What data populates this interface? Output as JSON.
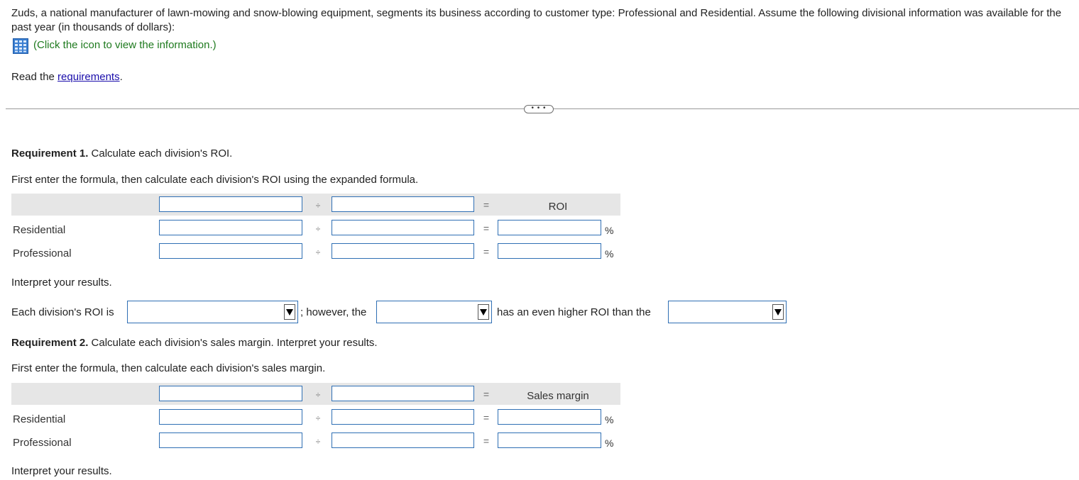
{
  "intro": {
    "text": "Zuds, a national manufacturer of lawn-mowing and snow-blowing equipment, segments its business according to customer type: Professional and Residential. Assume the following divisional information was available for the past year (in thousands of dollars):",
    "icon_hint": "(Click the icon to view the information.)",
    "read_prefix": "Read the ",
    "requirements_link": "requirements",
    "read_suffix": "."
  },
  "more_button": "• • •",
  "req1": {
    "label": "Requirement 1.",
    "text": " Calculate each division's ROI.",
    "instruction": "First enter the formula, then calculate each division's ROI using the expanded formula.",
    "result_header": "ROI",
    "divide_symbol": "÷",
    "equals_symbol": "=",
    "rows": [
      {
        "label": "Residential",
        "unit": "%"
      },
      {
        "label": "Professional",
        "unit": "%"
      }
    ],
    "interpret": "Interpret your results.",
    "sentence": {
      "part1": "Each division's ROI is",
      "part2": "; however, the",
      "part3": "has an even higher ROI than the"
    }
  },
  "req2": {
    "label": "Requirement 2.",
    "text": " Calculate each division's sales margin. Interpret your results.",
    "instruction": "First enter the formula, then calculate each division's sales margin.",
    "result_header": "Sales margin",
    "divide_symbol": "÷",
    "equals_symbol": "=",
    "rows": [
      {
        "label": "Residential",
        "unit": "%"
      },
      {
        "label": "Professional",
        "unit": "%"
      }
    ],
    "interpret": "Interpret your results."
  },
  "colors": {
    "input_border": "#2f6fb4",
    "link": "#1a0dab",
    "hint_green": "#1e7a1e",
    "header_bg": "#e6e6e6"
  }
}
